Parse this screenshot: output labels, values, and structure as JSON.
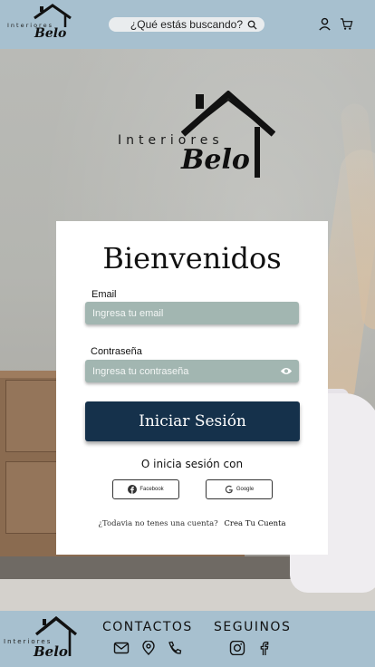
{
  "header": {
    "brand_top": "Interiores",
    "brand_bottom": "Belo",
    "search_placeholder": "¿Qué estás buscando?"
  },
  "hero": {
    "brand_top": "Interiores",
    "brand_bottom": "Belo"
  },
  "login": {
    "title": "Bienvenidos",
    "email_label": "Email",
    "email_placeholder": "Ingresa tu email",
    "password_label": "Contraseña",
    "password_placeholder": "Ingresa tu contraseña",
    "submit_label": "Iniciar Sesión",
    "alt_text": "O inicia sesión con",
    "facebook_label": "Facebook",
    "google_label": "Google",
    "signup_question": "¿Todavia no tenes una cuenta?",
    "signup_link": "Crea Tu Cuenta"
  },
  "footer": {
    "brand_top": "Interiores",
    "brand_bottom": "Belo",
    "contact_heading": "CONTACTOS",
    "follow_heading": "SEGUINOS"
  },
  "colors": {
    "header_bg": "#a7c0cf",
    "button_bg": "#15314b",
    "field_bg": "#a2b6b1"
  }
}
